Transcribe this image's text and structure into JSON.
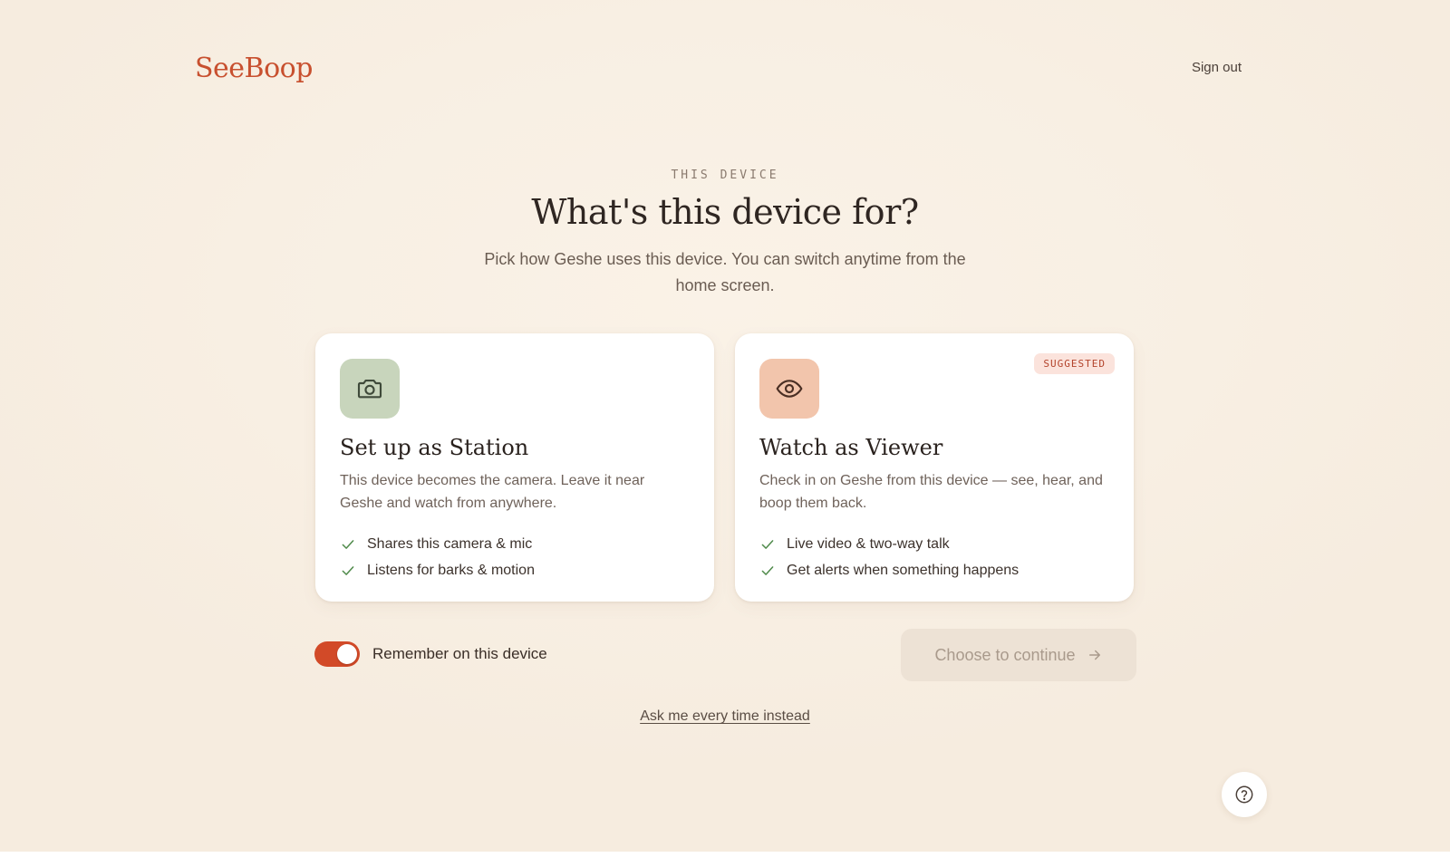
{
  "header": {
    "logo": "SeeBoop",
    "sign_out": "Sign out"
  },
  "intro": {
    "eyebrow": "THIS DEVICE",
    "title": "What's this device for?",
    "subtitle": "Pick how Geshe uses this device. You can switch anytime from the home screen."
  },
  "options": {
    "station": {
      "icon": "camera-icon",
      "title": "Set up as Station",
      "description": "This device becomes the camera. Leave it near Geshe and watch from anywhere.",
      "features": [
        "Shares this camera & mic",
        "Listens for barks & motion"
      ]
    },
    "viewer": {
      "icon": "eye-icon",
      "badge": "SUGGESTED",
      "title": "Watch as Viewer",
      "description": "Check in on Geshe from this device — see, hear, and boop them back.",
      "features": [
        "Live video & two-way talk",
        "Get alerts when something happens"
      ]
    }
  },
  "controls": {
    "remember_label": "Remember on this device",
    "remember_on": true,
    "continue_label": "Choose to continue",
    "continue_disabled": true,
    "ask_link": "Ask me every time instead"
  },
  "help": {
    "icon": "help-icon"
  },
  "colors": {
    "brand": "#c8502f",
    "toggle_on": "#d24a28",
    "station_icon_bg": "#c8d5bc",
    "viewer_icon_bg": "#f2c5ac",
    "check": "#4f8a4a",
    "background": "#f7ede0"
  }
}
